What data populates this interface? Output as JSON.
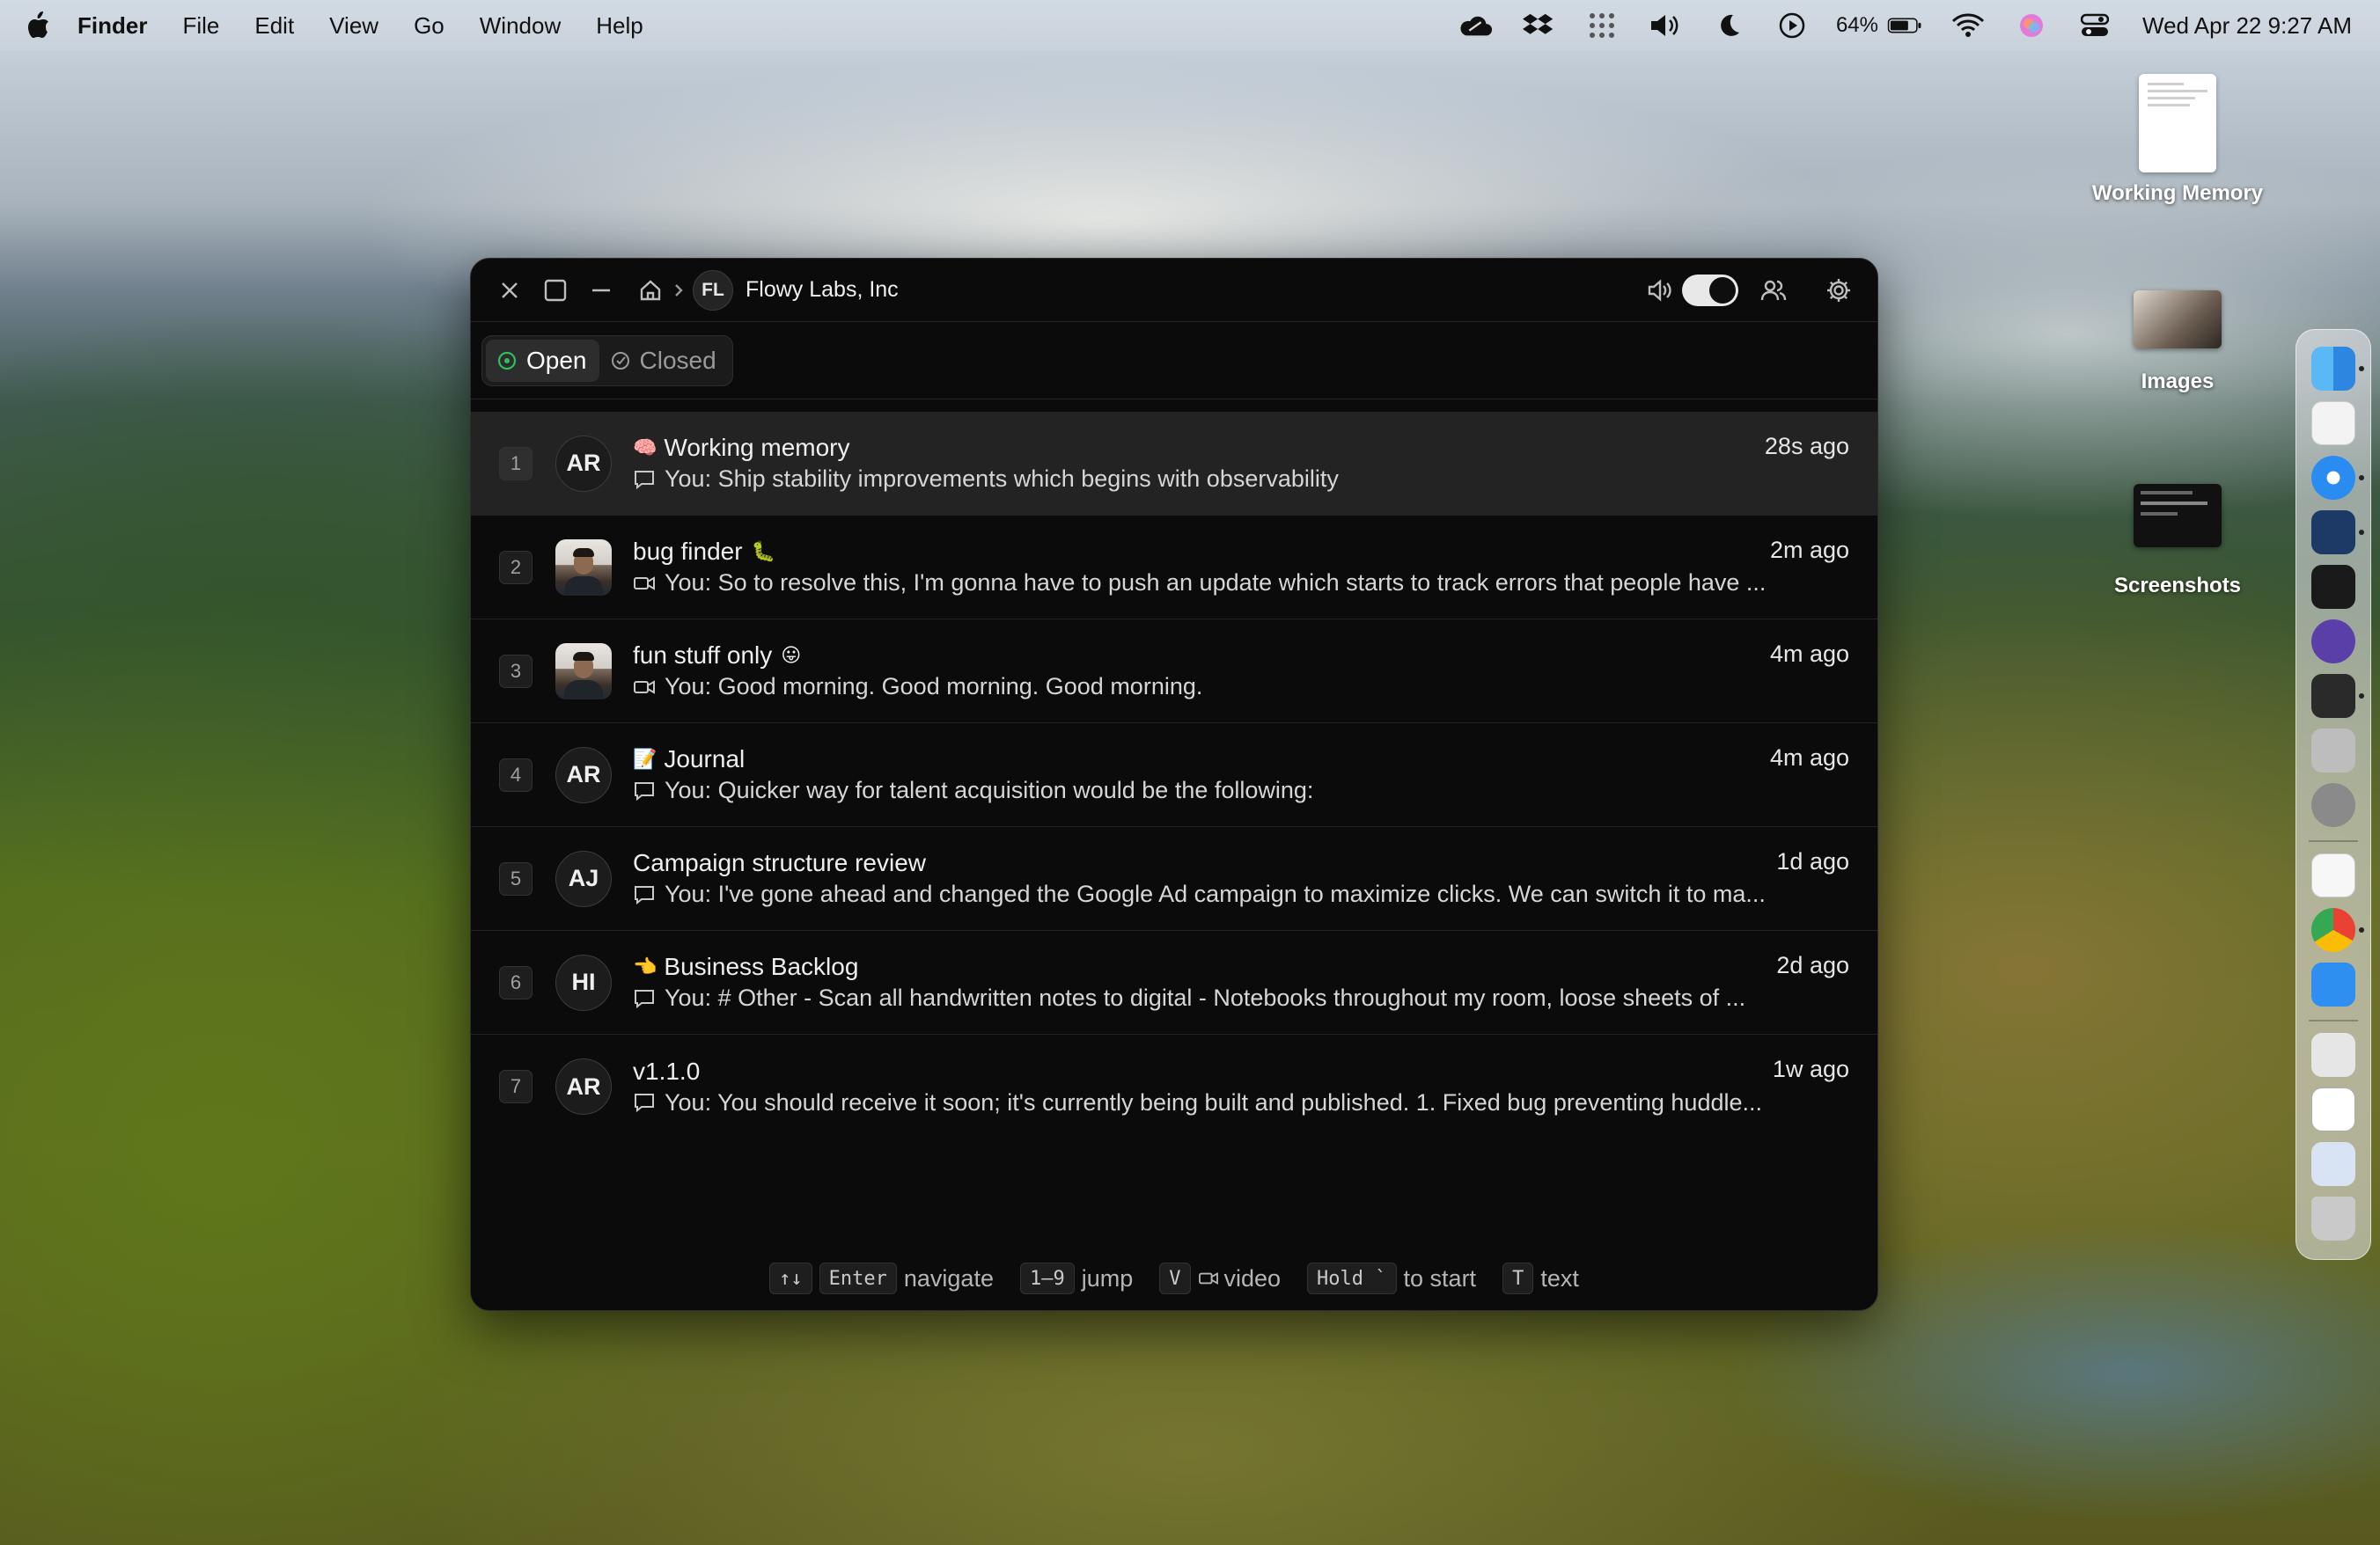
{
  "menubar": {
    "app_name": "Finder",
    "menus": [
      "File",
      "Edit",
      "View",
      "Go",
      "Window",
      "Help"
    ],
    "battery": "64%",
    "clock": "Wed Apr 22  9:27 AM"
  },
  "desktop": {
    "icons": [
      {
        "label": "Working Memory"
      },
      {
        "label": "Images"
      },
      {
        "label": "Screenshots"
      }
    ]
  },
  "window": {
    "breadcrumb": {
      "org_initials": "FL",
      "org_name": "Flowy Labs, Inc"
    },
    "tabs": {
      "open": "Open",
      "closed": "Closed"
    },
    "rows": [
      {
        "num": "1",
        "avatar": "AR",
        "emoji": "🧠",
        "title": "Working memory",
        "kind": "text",
        "preview": "You: Ship stability improvements which begins with observability",
        "time": "28s ago"
      },
      {
        "num": "2",
        "avatar": "",
        "emoji": "🐛",
        "title": "bug finder",
        "kind": "video",
        "preview": "You: So to resolve this, I'm gonna have to push an update which starts to track errors that people have ...",
        "time": "2m ago"
      },
      {
        "num": "3",
        "avatar": "",
        "emoji": "😛",
        "title": "fun stuff only",
        "kind": "video",
        "preview": "You: Good morning. Good morning. Good morning.",
        "time": "4m ago"
      },
      {
        "num": "4",
        "avatar": "AR",
        "emoji": "📝",
        "title": "Journal",
        "kind": "text",
        "preview": "You: Quicker way for talent acquisition would be the following:",
        "time": "4m ago"
      },
      {
        "num": "5",
        "avatar": "AJ",
        "emoji": "",
        "title": "Campaign structure review",
        "kind": "text",
        "preview": "You: I've gone ahead and changed the Google Ad campaign to maximize clicks. We can switch it to ma...",
        "time": "1d ago"
      },
      {
        "num": "6",
        "avatar": "HI",
        "emoji": "👈",
        "title": "Business Backlog",
        "kind": "text",
        "preview": "You: # Other - Scan all handwritten notes to digital - Notebooks throughout my room, loose sheets of ...",
        "time": "2d ago"
      },
      {
        "num": "7",
        "avatar": "AR",
        "emoji": "",
        "title": "v1.1.0",
        "kind": "text",
        "preview": "You: You should receive it soon; it's currently being built and published. 1. Fixed bug preventing huddle...",
        "time": "1w ago"
      }
    ],
    "hints": {
      "arrows_key": "↑↓",
      "enter_key": "Enter",
      "navigate": "navigate",
      "jump_key": "1–9",
      "jump": "jump",
      "video_key": "V",
      "video": "video",
      "hold_key": "Hold `",
      "start": "to start",
      "text_key": "T",
      "text": "text"
    }
  },
  "colors": {
    "window_bg": "#0b0b0b",
    "selected_row": "#232323",
    "open_indicator": "#2fbf5a"
  }
}
